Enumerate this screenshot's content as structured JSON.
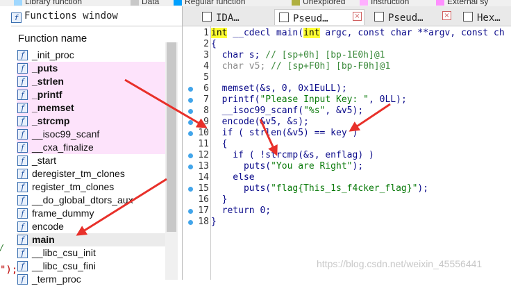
{
  "legend": [
    {
      "label": "Library function",
      "color": "#a0d8ff"
    },
    {
      "label": "Data",
      "color": "#c8c8c8"
    },
    {
      "label": "Regular function",
      "color": "#00a0ff"
    },
    {
      "label": "Unexplored",
      "color": "#b0b040"
    },
    {
      "label": "Instruction",
      "color": "#ffb0ff"
    },
    {
      "label": "External sy",
      "color": "#ff90ff"
    }
  ],
  "functions_window": {
    "title": "Functions window",
    "column_header": "Function name",
    "left_fragment_1": "/",
    "left_fragment_2": "\");",
    "items": [
      {
        "label": "_init_proc",
        "style": "normal"
      },
      {
        "label": "_puts",
        "style": "pink-bold"
      },
      {
        "label": "_strlen",
        "style": "pink-bold"
      },
      {
        "label": "_printf",
        "style": "pink-bold"
      },
      {
        "label": "_memset",
        "style": "pink-bold"
      },
      {
        "label": "_strcmp",
        "style": "pink-bold"
      },
      {
        "label": "__isoc99_scanf",
        "style": "pink"
      },
      {
        "label": "__cxa_finalize",
        "style": "pink"
      },
      {
        "label": "_start",
        "style": "normal"
      },
      {
        "label": "deregister_tm_clones",
        "style": "normal"
      },
      {
        "label": "register_tm_clones",
        "style": "normal"
      },
      {
        "label": "__do_global_dtors_aux",
        "style": "normal"
      },
      {
        "label": "frame_dummy",
        "style": "normal"
      },
      {
        "label": "encode",
        "style": "normal"
      },
      {
        "label": "main",
        "style": "selected-bold"
      },
      {
        "label": "__libc_csu_init",
        "style": "normal"
      },
      {
        "label": "__libc_csu_fini",
        "style": "normal"
      },
      {
        "label": "_term_proc",
        "style": "normal"
      }
    ]
  },
  "tabs": [
    {
      "label": "IDA…",
      "active": false,
      "closable": false
    },
    {
      "label": "Pseud…",
      "active": true,
      "closable": true
    },
    {
      "label": "Pseud…",
      "active": false,
      "closable": true
    },
    {
      "label": "Hex…",
      "active": false,
      "closable": false
    }
  ],
  "code": [
    {
      "n": "1",
      "dot": false,
      "segs": [
        [
          "int",
          "kw-hl"
        ],
        [
          " __cdecl main(",
          ""
        ],
        [
          "int",
          "kw-hl"
        ],
        [
          " argc, const char **argv, const ch",
          ""
        ]
      ]
    },
    {
      "n": "2",
      "dot": false,
      "segs": [
        [
          "{",
          ""
        ]
      ]
    },
    {
      "n": "3",
      "dot": false,
      "segs": [
        [
          "  char s; ",
          ""
        ],
        [
          "// [sp+0h] [bp-1E0h]@1",
          "cmt"
        ]
      ]
    },
    {
      "n": "4",
      "dot": false,
      "segs": [
        [
          "  char v5; ",
          "faint"
        ],
        [
          "// [sp+F0h] [bp-F0h]@1",
          "cmt"
        ]
      ]
    },
    {
      "n": "5",
      "dot": false,
      "segs": [
        [
          "",
          ""
        ]
      ]
    },
    {
      "n": "6",
      "dot": true,
      "segs": [
        [
          "  memset(&s, 0, 0x1EuLL);",
          ""
        ]
      ]
    },
    {
      "n": "7",
      "dot": true,
      "segs": [
        [
          "  printf(",
          ""
        ],
        [
          "\"Please Input Key: \"",
          "str"
        ],
        [
          ", 0LL);",
          ""
        ]
      ]
    },
    {
      "n": "8",
      "dot": true,
      "segs": [
        [
          "  __isoc99_scanf(",
          ""
        ],
        [
          "\"%s\"",
          "str"
        ],
        [
          ", &v5);",
          ""
        ]
      ]
    },
    {
      "n": "9",
      "dot": true,
      "segs": [
        [
          "  encode(&v5, &s);",
          ""
        ]
      ]
    },
    {
      "n": "10",
      "dot": true,
      "segs": [
        [
          "  if ( strlen(&v5) == key )",
          ""
        ]
      ]
    },
    {
      "n": "11",
      "dot": false,
      "segs": [
        [
          "  {",
          ""
        ]
      ]
    },
    {
      "n": "12",
      "dot": true,
      "segs": [
        [
          "    if ( !strcmp(&s, enflag) )",
          ""
        ]
      ]
    },
    {
      "n": "13",
      "dot": true,
      "segs": [
        [
          "      puts(",
          ""
        ],
        [
          "\"You are Right\"",
          "str"
        ],
        [
          ");",
          ""
        ]
      ]
    },
    {
      "n": "14",
      "dot": false,
      "segs": [
        [
          "    else",
          ""
        ]
      ]
    },
    {
      "n": "15",
      "dot": true,
      "segs": [
        [
          "      puts(",
          ""
        ],
        [
          "\"flag{This_1s_f4cker_flag}\"",
          "str"
        ],
        [
          ");",
          ""
        ]
      ]
    },
    {
      "n": "16",
      "dot": false,
      "segs": [
        [
          "  }",
          ""
        ]
      ]
    },
    {
      "n": "17",
      "dot": true,
      "segs": [
        [
          "  return 0;",
          ""
        ]
      ]
    },
    {
      "n": "18",
      "dot": true,
      "segs": [
        [
          "}",
          ""
        ]
      ]
    }
  ],
  "watermark": "https://blog.csdn.net/weixin_45556441",
  "colors": {
    "arrow": "#e8302a",
    "pink_row": "#fde3fb",
    "breakpoint_dot": "#42a5ea"
  }
}
